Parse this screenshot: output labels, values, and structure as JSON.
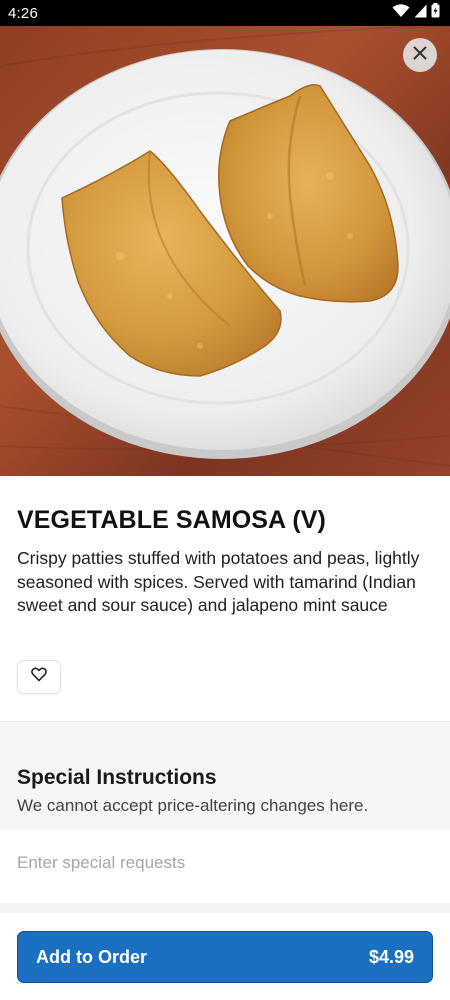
{
  "status_bar": {
    "time": "4:26"
  },
  "item": {
    "title": "VEGETABLE SAMOSA (V)",
    "description": "Crispy patties stuffed with potatoes and peas, lightly seasoned with spices. Served with tamarind (Indian sweet and sour sauce) and jalapeno mint sauce"
  },
  "icons": {
    "close": "close-icon",
    "favorite": "heart-icon",
    "wifi": "wifi-icon",
    "signal": "signal-icon",
    "battery": "battery-icon"
  },
  "special_instructions": {
    "title": "Special Instructions",
    "subtitle": "We cannot accept price-altering changes here.",
    "placeholder": "Enter special requests"
  },
  "order_button": {
    "label": "Add to Order",
    "price": "$4.99"
  },
  "colors": {
    "primary": "#1a6fc0",
    "status_bar": "#000000",
    "section_bg": "#f6f5f8"
  }
}
